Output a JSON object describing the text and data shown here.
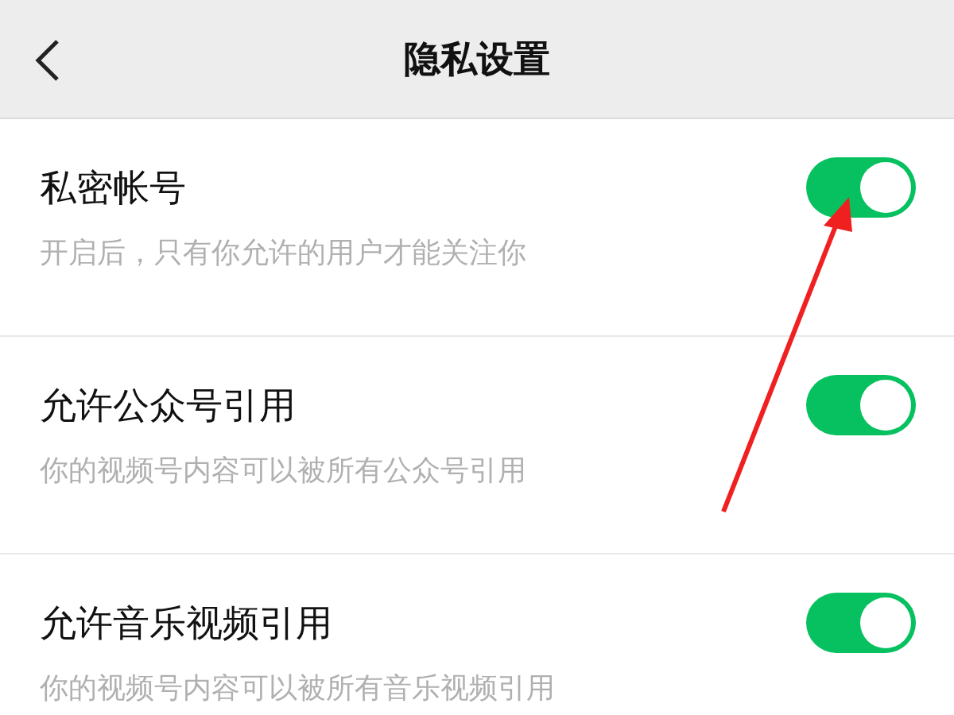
{
  "header": {
    "title": "隐私设置"
  },
  "settings": [
    {
      "title": "私密帐号",
      "description": "开启后，只有你允许的用户才能关注你",
      "on": true
    },
    {
      "title": "允许公众号引用",
      "description": "你的视频号内容可以被所有公众号引用",
      "on": true
    },
    {
      "title": "允许音乐视频引用",
      "description": "你的视频号内容可以被所有音乐视频引用",
      "on": true
    }
  ]
}
